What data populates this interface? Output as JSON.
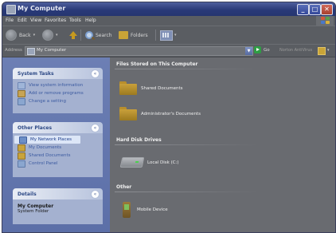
{
  "window": {
    "title": "My Computer",
    "buttons": {
      "minimize": "_",
      "maximize": "□",
      "close": "✕"
    }
  },
  "menu": [
    "File",
    "Edit",
    "View",
    "Favorites",
    "Tools",
    "Help"
  ],
  "toolbar": {
    "back": "Back",
    "search": "Search",
    "folders": "Folders"
  },
  "address": {
    "label": "Address",
    "value": "My Computer",
    "go": "Go",
    "norton": "Norton AntiVirus"
  },
  "sidebar": {
    "system_tasks": {
      "title": "System Tasks",
      "items": [
        "View system information",
        "Add or remove programs",
        "Change a setting"
      ]
    },
    "other_places": {
      "title": "Other Places",
      "items": [
        "My Network Places",
        "My Documents",
        "Shared Documents",
        "Control Panel"
      ]
    },
    "details": {
      "title": "Details",
      "name": "My Computer",
      "subtitle": "System Folder"
    }
  },
  "main": {
    "sections": [
      {
        "title": "Files Stored on This Computer",
        "items": [
          "Shared Documents",
          "Administrator's Documents"
        ]
      },
      {
        "title": "Hard Disk Drives",
        "items": [
          "Local Disk (C:)"
        ]
      },
      {
        "title": "Other",
        "items": [
          "Mobile Device"
        ]
      }
    ]
  },
  "colors": {
    "titlebar": "#2a3a78",
    "sidebar": "#6c7fb4",
    "panel_body": "#a4b1d0",
    "link": "#3b5aa0",
    "content_bg": "#696b70"
  },
  "icons": {
    "window": "my-computer-icon",
    "back": "back-arrow-icon",
    "forward": "forward-arrow-icon",
    "up": "up-folder-icon",
    "search": "search-icon",
    "folders": "folders-icon",
    "views": "views-icon",
    "go": "go-arrow-icon",
    "norton": "norton-icon"
  }
}
